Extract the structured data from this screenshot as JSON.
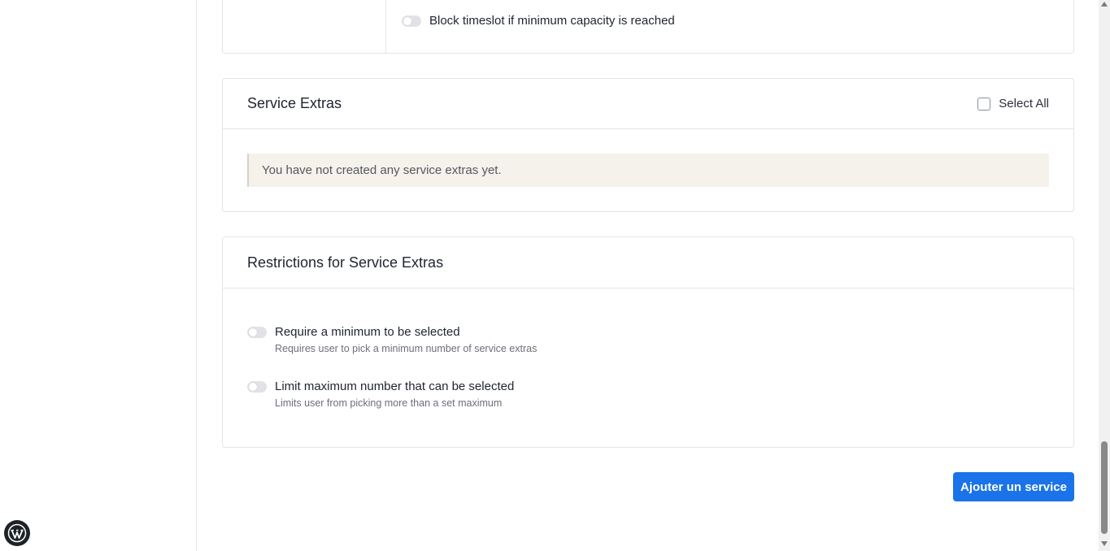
{
  "capacity": {
    "block_label": "Block timeslot if minimum capacity is reached",
    "block_enabled": false
  },
  "service_extras": {
    "title": "Service Extras",
    "select_all_label": "Select All",
    "select_all_checked": false,
    "empty_notice": "You have not created any service extras yet."
  },
  "restrictions": {
    "title": "Restrictions for Service Extras",
    "items": [
      {
        "label": "Require a minimum to be selected",
        "description": "Requires user to pick a minimum number of service extras",
        "enabled": false
      },
      {
        "label": "Limit maximum number that can be selected",
        "description": "Limits user from picking more than a set maximum",
        "enabled": false
      }
    ]
  },
  "actions": {
    "submit_label": "Ajouter un service"
  },
  "icons": {
    "wp_badge": "wordpress-icon"
  },
  "colors": {
    "accent": "#1a73e8",
    "notice_bg": "#f5f2ec"
  }
}
